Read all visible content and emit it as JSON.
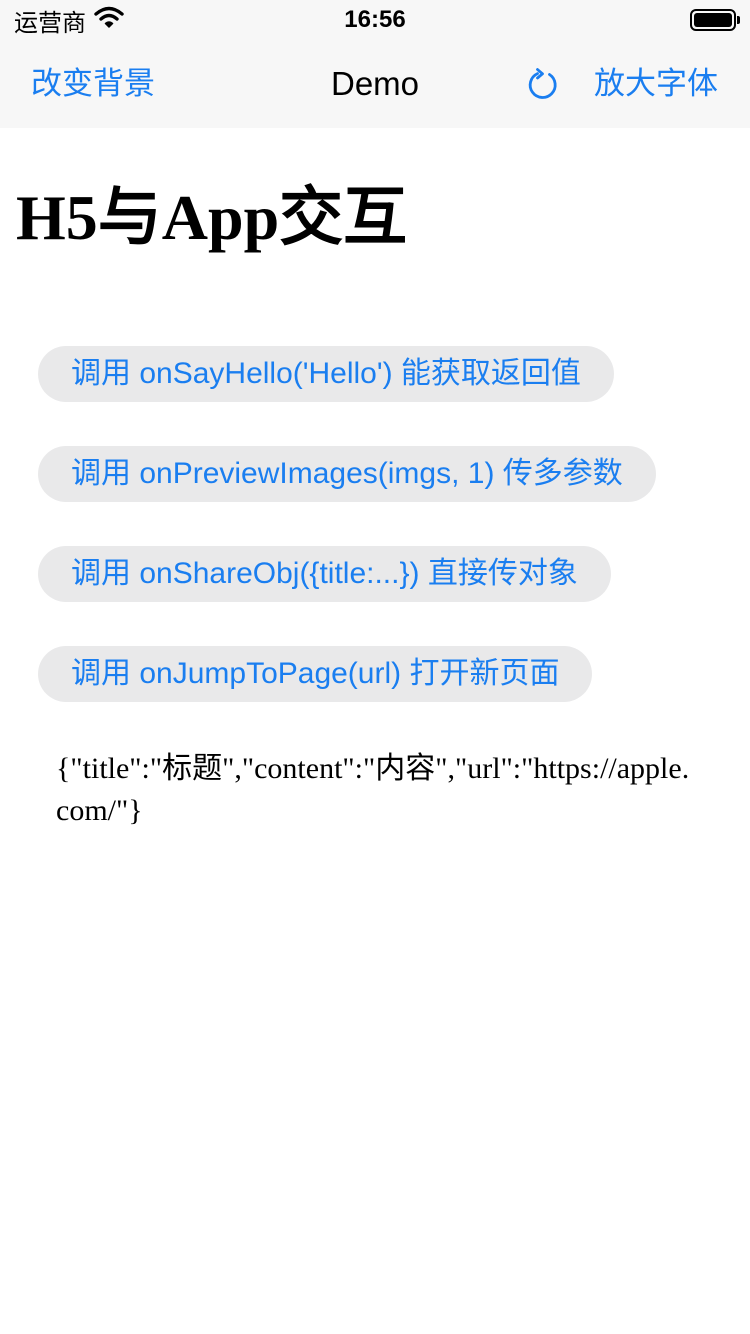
{
  "status_bar": {
    "carrier": "运营商",
    "time": "16:56",
    "battery_level": 1.0
  },
  "nav_bar": {
    "left_button": "改变背景",
    "title": "Demo",
    "refresh_icon": "refresh-icon",
    "right_button": "放大字体"
  },
  "page": {
    "heading": "H5与App交互",
    "buttons": [
      {
        "label": "调用 onSayHello('Hello') 能获取返回值"
      },
      {
        "label": "调用 onPreviewImages(imgs, 1) 传多参数"
      },
      {
        "label": "调用 onShareObj({title:...}) 直接传对象"
      },
      {
        "label": "调用 onJumpToPage(url) 打开新页面"
      }
    ],
    "result": "{\"title\":\"标题\",\"content\":\"内容\",\"url\":\"https://apple.com/\"}"
  },
  "colors": {
    "accent": "#1a7ef0",
    "button_background": "#e9e9ea",
    "bar_background": "#f7f7f7"
  }
}
